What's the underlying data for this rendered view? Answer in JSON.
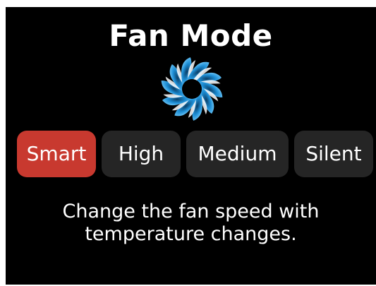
{
  "header": {
    "title": "Fan Mode"
  },
  "fan_icon": {
    "name": "fan-icon",
    "colors": [
      "#1e8fd6",
      "#6cc4f5",
      "#ffffff"
    ]
  },
  "modes": [
    {
      "label": "Smart",
      "selected": true
    },
    {
      "label": "High",
      "selected": false
    },
    {
      "label": "Medium",
      "selected": false
    },
    {
      "label": "Silent",
      "selected": false
    }
  ],
  "description": {
    "line1": "Change the fan speed with",
    "line2": "temperature changes."
  },
  "colors": {
    "background": "#000000",
    "button": "#252525",
    "accent": "#c8392f",
    "text": "#ffffff"
  }
}
